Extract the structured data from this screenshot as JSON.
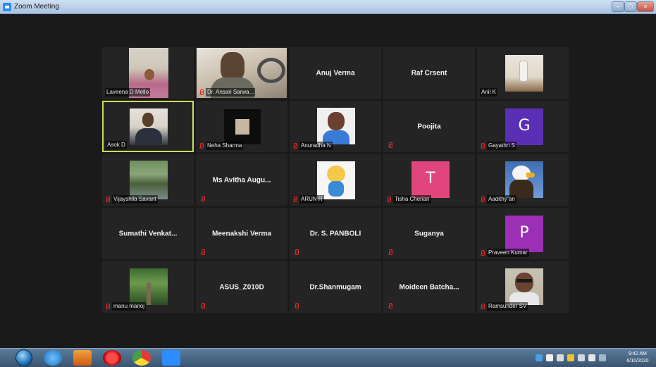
{
  "window": {
    "title": "Zoom Meeting"
  },
  "participants": {
    "laveena": "Laveena D Mello",
    "ansari": "Dr. Ansari Sarwa...",
    "anuj": "Anuj Verma",
    "raf": "Raf Crsent",
    "anil": "Anil K",
    "asok": "Asok D",
    "neha": "Neha Sharma",
    "anuradha": "Anuradha N",
    "poojita": "Poojita",
    "gayathri": "Gayathri S",
    "gayathri_letter": "G",
    "vijayshila": "Vijayshila Savant",
    "avitha": "Ms Avitha Augu...",
    "arun": "ARUN R",
    "tisha": "Tisha Cherian",
    "tisha_letter": "T",
    "aadithyan": "Aadithy an",
    "sumathi": "Sumathi Venkat...",
    "meenakshi": "Meenakshi Verma",
    "panboli": "Dr. S. PANBOLI",
    "suganya": "Suganya",
    "praveen": "Praveen Kumar",
    "praveen_letter": "P",
    "manoj": "manu manoj",
    "asus": "ASUS_Z010D",
    "shanmugam": "Dr.Shanmugam",
    "moideen": "Moideen Batcha...",
    "ramsunder": "Ramsunder SV"
  },
  "taskbar": {
    "time": "9:42 AM",
    "date": "6/10/2020"
  },
  "colors": {
    "active_speaker_border": "#c9e05a",
    "gayathri_avatar": "#5a2fb5",
    "tisha_avatar": "#e0467c",
    "praveen_avatar": "#9b2fb5",
    "tile_bg": "#242424"
  }
}
